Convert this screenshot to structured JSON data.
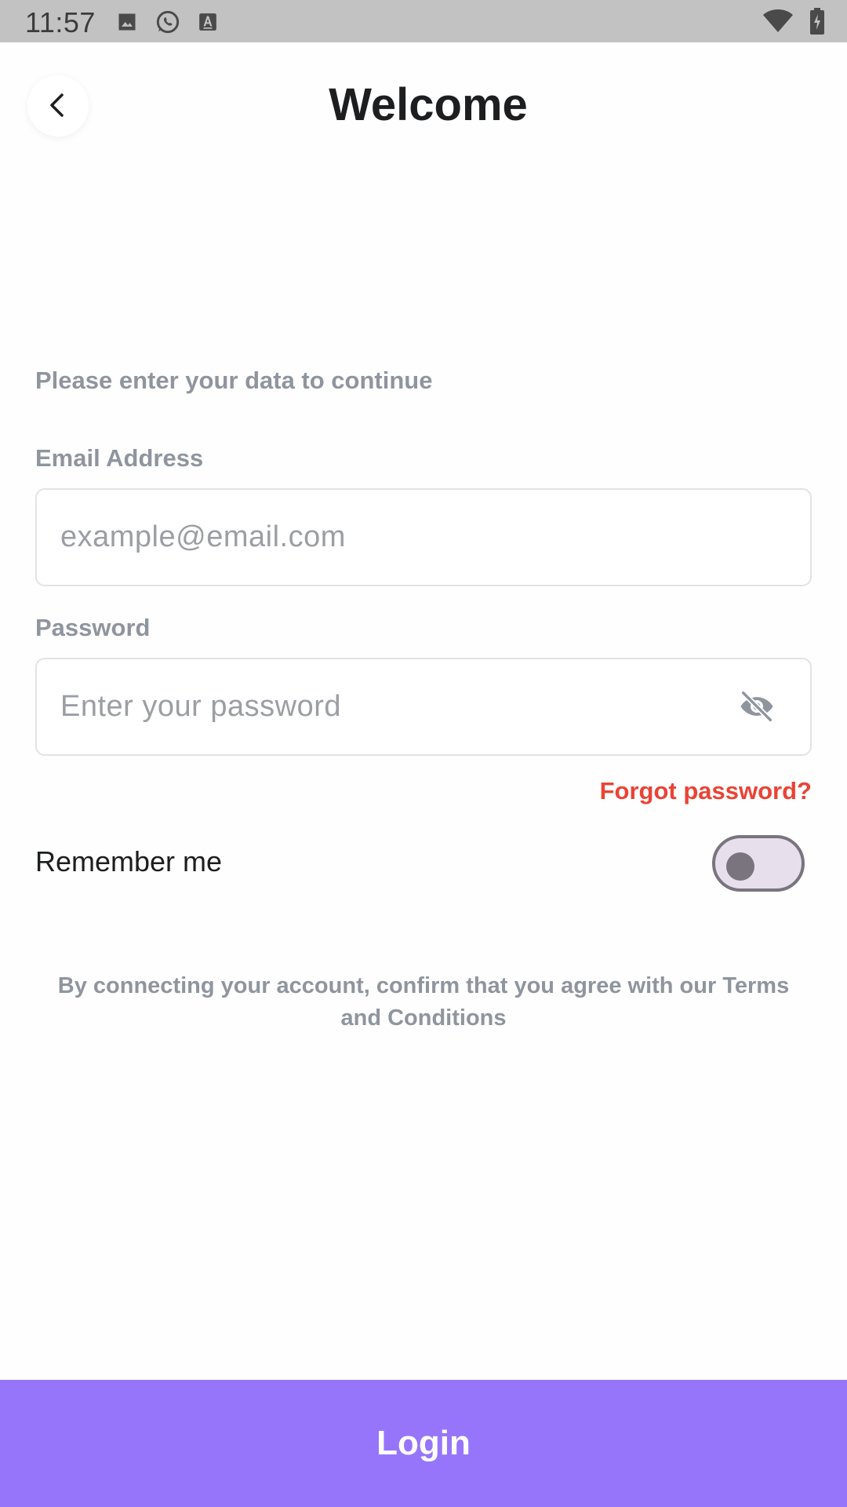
{
  "status_bar": {
    "time": "11:57",
    "left_icons": [
      "image-icon",
      "whatsapp-icon",
      "keyboard-icon"
    ],
    "right_icons": [
      "wifi-icon",
      "battery-charging-icon"
    ]
  },
  "header": {
    "title": "Welcome",
    "back_icon": "chevron-left-icon"
  },
  "form": {
    "subtitle": "Please enter your data to continue",
    "email": {
      "label": "Email Address",
      "placeholder": "example@email.com",
      "value": ""
    },
    "password": {
      "label": "Password",
      "placeholder": "Enter your password",
      "value": "",
      "visibility_icon": "eye-off-icon"
    },
    "forgot_password": "Forgot password?",
    "remember_me": {
      "label": "Remember me",
      "checked": false
    },
    "terms": "By connecting your account, confirm that you agree with our Terms and Conditions"
  },
  "actions": {
    "login_label": "Login"
  },
  "colors": {
    "accent": "#9775fa",
    "link": "#ea4335",
    "muted_text": "#8f959e",
    "status_bar": "#c2c2c2"
  }
}
